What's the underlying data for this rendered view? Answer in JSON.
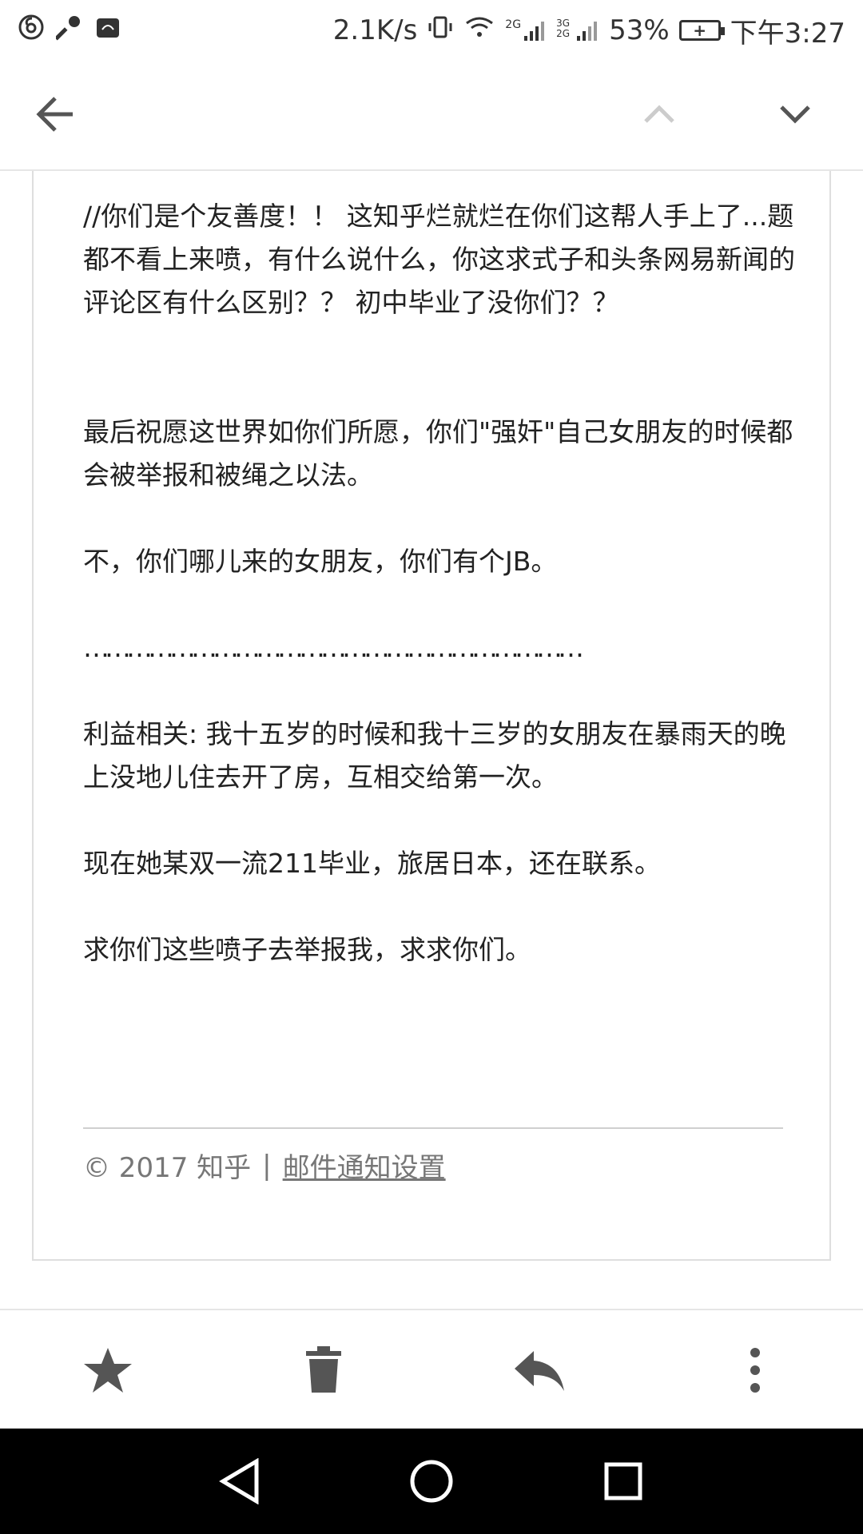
{
  "status_bar": {
    "left_icons": [
      "netease-music-icon",
      "key-icon",
      "huawei-icon"
    ],
    "speed": "2.1K/s",
    "network_labels": [
      "2G",
      "3G 2G"
    ],
    "battery_percent": "53%",
    "time": "下午3:27"
  },
  "email": {
    "paragraphs": [
      "//你们是个友善度！！ 这知乎烂就烂在你们这帮人手上了...题都不看上来喷，有什么说什么，你这求式子和头条网易新闻的评论区有什么区别？？ 初中毕业了没你们？？",
      "最后祝愿这世界如你们所愿，你们\"强奸\"自己女朋友的时候都会被举报和被绳之以法。",
      "不，你们哪儿来的女朋友，你们有个JB。",
      "……………………………………………………………",
      "利益相关: 我十五岁的时候和我十三岁的女朋友在暴雨天的晚上没地儿住去开了房，互相交给第一次。",
      "现在她某双一流211毕业，旅居日本，还在联系。",
      "求你们这些喷子去举报我，求求你们。"
    ],
    "footer": {
      "copyright": "© 2017 知乎",
      "divider": "|",
      "settings_link": "邮件通知设置"
    }
  },
  "colors": {
    "background": "#ffffff",
    "text": "#222222",
    "icon": "#555555",
    "muted": "#777777",
    "navbar": "#000000"
  }
}
